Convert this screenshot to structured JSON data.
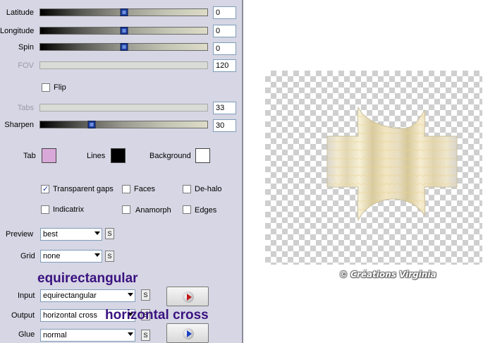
{
  "sliders": {
    "latitude": {
      "label": "Latitude",
      "value": "0",
      "position": 0.5
    },
    "longitude": {
      "label": "Longitude",
      "value": "0",
      "position": 0.5
    },
    "spin": {
      "label": "Spin",
      "value": "0",
      "position": 0.5
    },
    "fov": {
      "label": "FOV",
      "value": "120"
    },
    "tabs": {
      "label": "Tabs",
      "value": "33"
    },
    "sharpen": {
      "label": "Sharpen",
      "value": "30",
      "position": 0.31
    }
  },
  "flip": {
    "label": "Flip",
    "checked": false
  },
  "colors": {
    "tab": {
      "label": "Tab",
      "hex": "#d8a8d8"
    },
    "lines": {
      "label": "Lines",
      "hex": "#000000"
    },
    "background": {
      "label": "Background",
      "hex": "#ffffff"
    }
  },
  "options": {
    "transparent_gaps": {
      "label": "Transparent gaps",
      "checked": true
    },
    "faces": {
      "label": "Faces",
      "checked": false
    },
    "de_halo": {
      "label": "De-halo",
      "checked": false
    },
    "indicatrix": {
      "label": "Indicatrix",
      "checked": false
    },
    "anamorph": {
      "label": "Anamorph",
      "checked": false
    },
    "edges": {
      "label": "Edges",
      "checked": false
    }
  },
  "preview_select": {
    "label": "Preview",
    "value": "best"
  },
  "grid_select": {
    "label": "Grid",
    "value": "none"
  },
  "input_select": {
    "label": "Input",
    "value": "equirectangular"
  },
  "output_select": {
    "label": "Output",
    "value": "horizontal cross"
  },
  "glue_select": {
    "label": "Glue",
    "value": "normal"
  },
  "s_button_label": "S",
  "annotations": {
    "input_note": "equirectangular",
    "output_note": "horizontal cross"
  },
  "credit": "© Créations Virginia"
}
